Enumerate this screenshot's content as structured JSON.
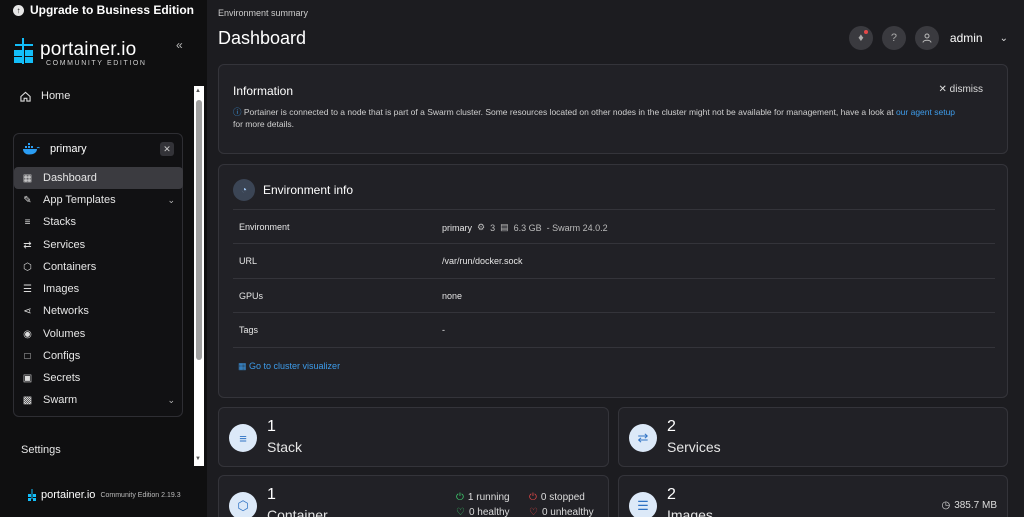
{
  "sidebar": {
    "upgrade_label": "Upgrade to Business Edition",
    "logo_main": "portainer.io",
    "logo_sub": "COMMUNITY EDITION",
    "home_label": "Home",
    "environment_name": "primary",
    "nav": [
      {
        "label": "Dashboard",
        "icon": "dashboard-icon",
        "active": true
      },
      {
        "label": "App Templates",
        "icon": "edit-icon",
        "has_chevron": true
      },
      {
        "label": "Stacks",
        "icon": "stacks-icon"
      },
      {
        "label": "Services",
        "icon": "shuffle-icon"
      },
      {
        "label": "Containers",
        "icon": "box-icon"
      },
      {
        "label": "Images",
        "icon": "list-icon"
      },
      {
        "label": "Networks",
        "icon": "share-icon"
      },
      {
        "label": "Volumes",
        "icon": "database-icon"
      },
      {
        "label": "Configs",
        "icon": "file-icon"
      },
      {
        "label": "Secrets",
        "icon": "lock-icon"
      },
      {
        "label": "Swarm",
        "icon": "grid-icon",
        "has_chevron": true
      }
    ],
    "settings_label": "Settings",
    "footer_logo": "portainer.io",
    "footer_version": "Community Edition 2.19.3"
  },
  "header": {
    "breadcrumb": "Environment summary",
    "title": "Dashboard",
    "user": "admin"
  },
  "information": {
    "title": "Information",
    "dismiss_label": "dismiss",
    "text": "Portainer is connected to a node that is part of a Swarm cluster. Some resources located on other nodes in the cluster might not be available for management, have a look at",
    "link": "our agent setup",
    "text_after": "for more details."
  },
  "environment_info": {
    "title": "Environment info",
    "rows": [
      {
        "label": "Environment",
        "value": "primary"
      },
      {
        "label": "URL",
        "value": "/var/run/docker.sock"
      },
      {
        "label": "GPUs",
        "value": "none"
      },
      {
        "label": "Tags",
        "value": "-"
      }
    ],
    "cpu": "3",
    "memory": "6.3 GB",
    "swarm": "- Swarm 24.0.2",
    "visualizer_link": "Go to cluster visualizer"
  },
  "stats": {
    "stack": {
      "count": "1",
      "label": "Stack"
    },
    "services": {
      "count": "2",
      "label": "Services"
    },
    "container": {
      "count": "1",
      "label": "Container",
      "running": "1 running",
      "stopped": "0 stopped",
      "healthy": "0 healthy",
      "unhealthy": "0 unhealthy"
    },
    "images": {
      "count": "2",
      "label": "Images",
      "size": "385.7 MB"
    }
  },
  "colors": {
    "accent": "#3d9be9",
    "background": "#1c1c20",
    "sidebar": "#0f0f10",
    "card": "#212126"
  }
}
